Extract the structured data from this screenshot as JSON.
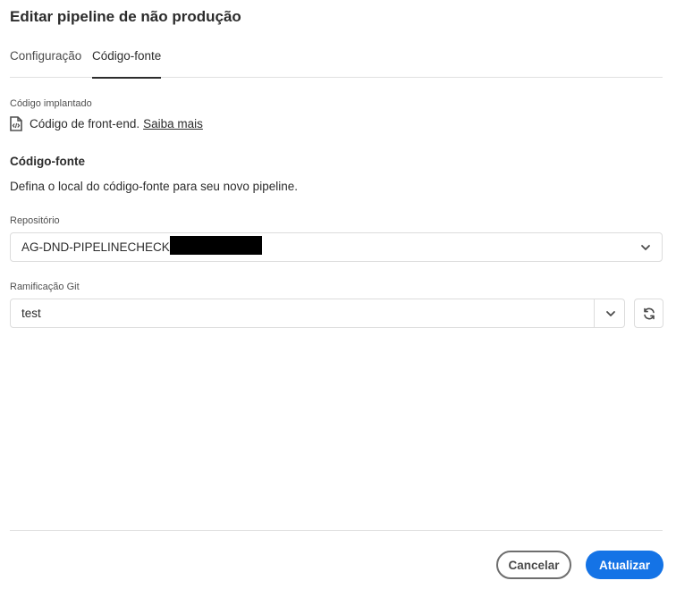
{
  "dialog": {
    "title": "Editar pipeline de não produção"
  },
  "tabs": [
    {
      "label": "Configuração",
      "selected": false
    },
    {
      "label": "Código-fonte",
      "selected": true
    }
  ],
  "deployed": {
    "label": "Código implantado",
    "icon": "file-code-icon",
    "value": "Código de front-end.",
    "link": "Saiba mais"
  },
  "source": {
    "title": "Código-fonte",
    "description": "Defina o local do código-fonte para seu novo pipeline."
  },
  "repository": {
    "label": "Repositório",
    "value": "AG-DND-PIPELINECHECK3-p"
  },
  "branch": {
    "label": "Ramificação Git",
    "value": "test"
  },
  "footer": {
    "cancel_label": "Cancelar",
    "update_label": "Atualizar"
  },
  "colors": {
    "accent": "#1473e6",
    "text": "#2c2c2c",
    "border": "#dcdcdc"
  }
}
